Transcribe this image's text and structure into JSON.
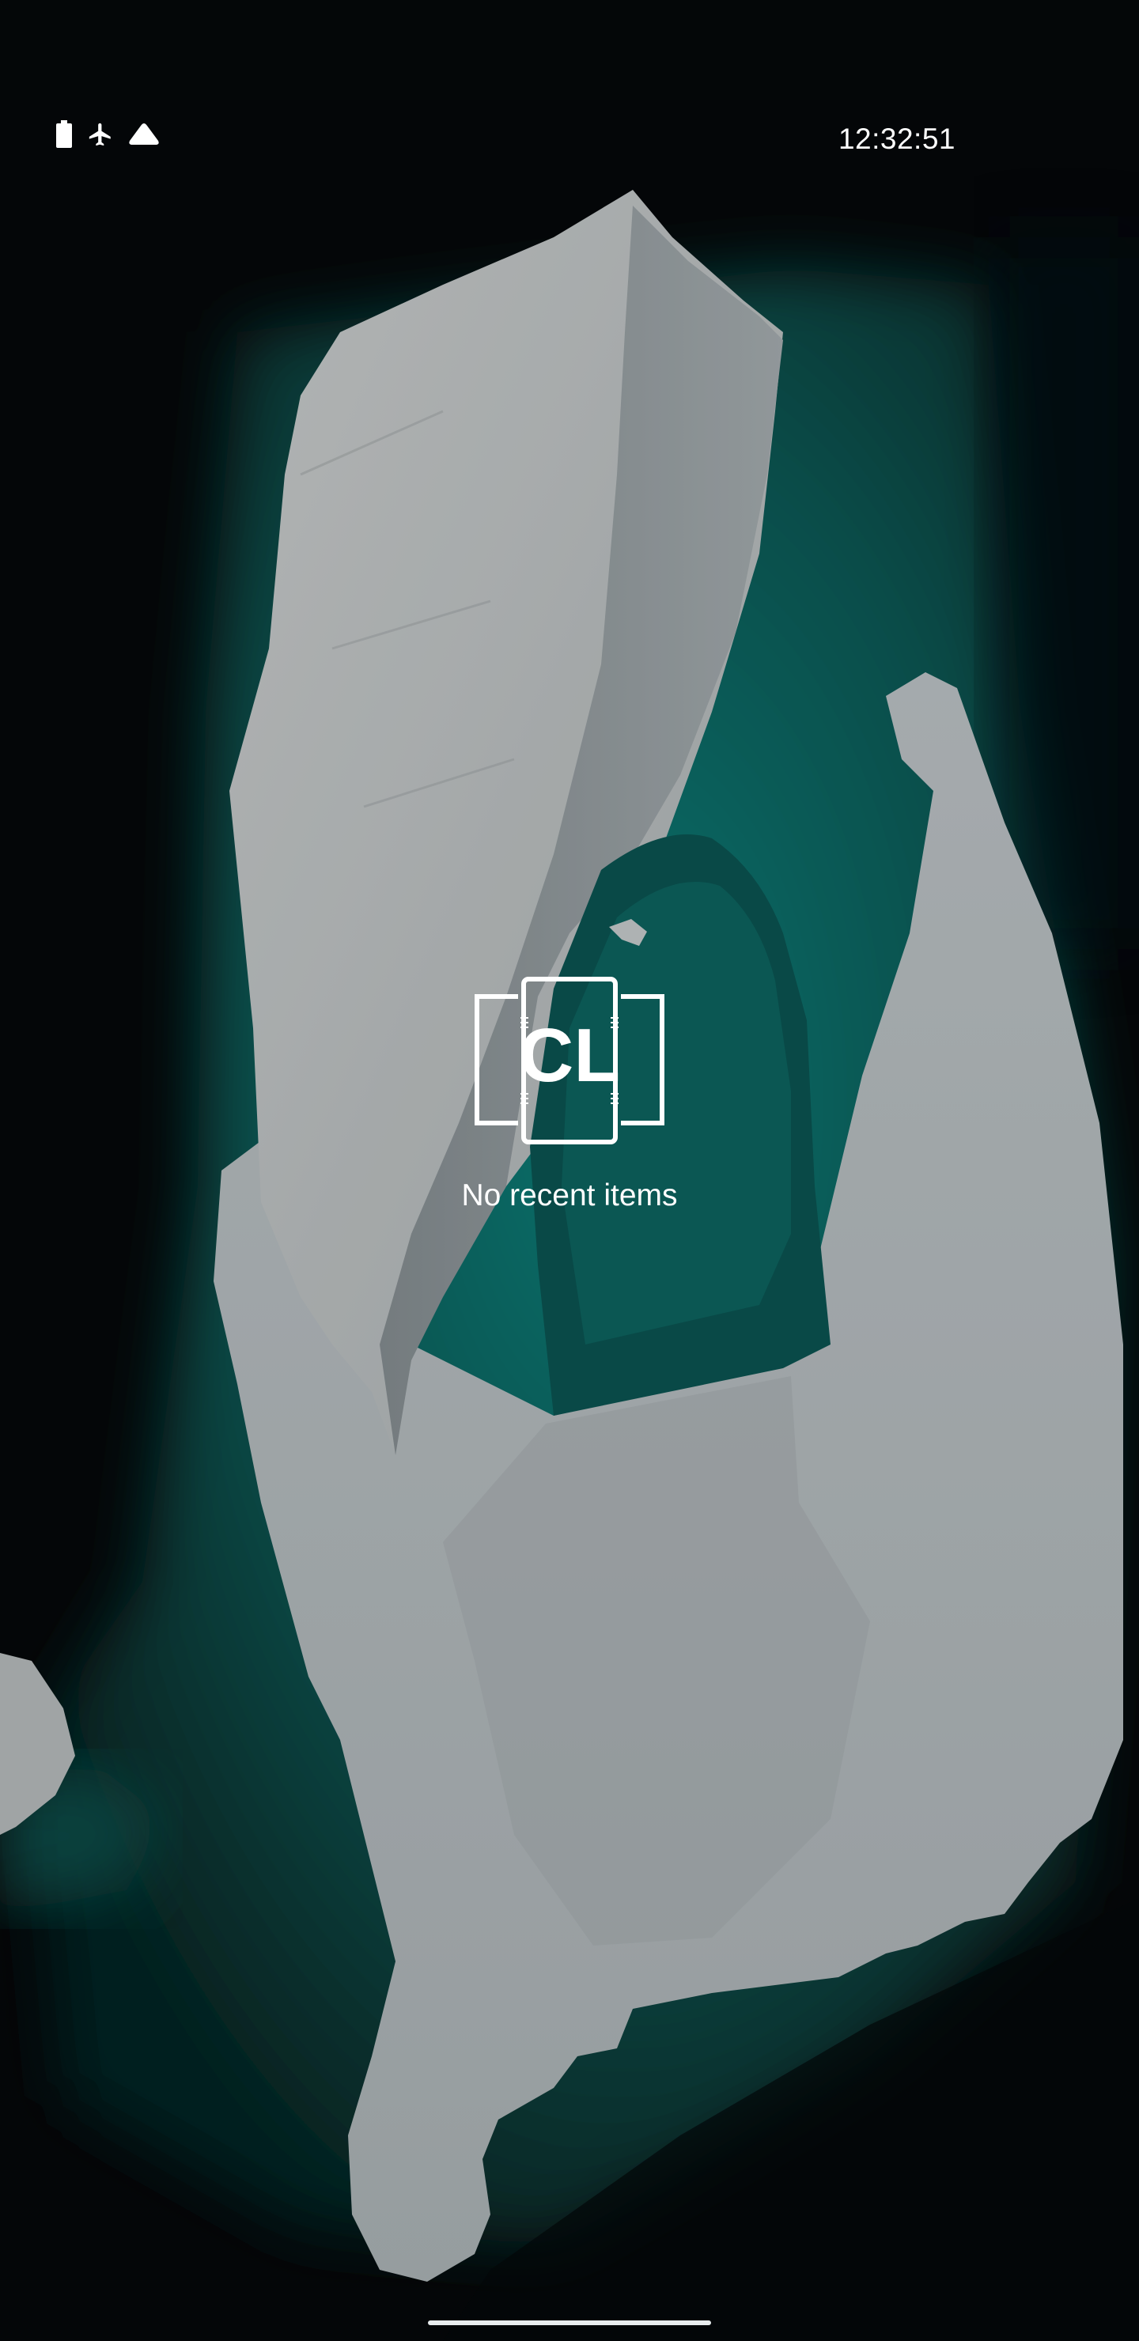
{
  "status_bar": {
    "time": "12:32:51",
    "icons": [
      "battery-icon",
      "airplane-mode-icon",
      "data-saver-icon"
    ]
  },
  "recents": {
    "logo_text": "CL",
    "empty_message": "No recent items"
  },
  "colors": {
    "water": "#0d6b67",
    "ice": "#cfd6d9",
    "background": "#06090b",
    "text": "#ffffff"
  }
}
